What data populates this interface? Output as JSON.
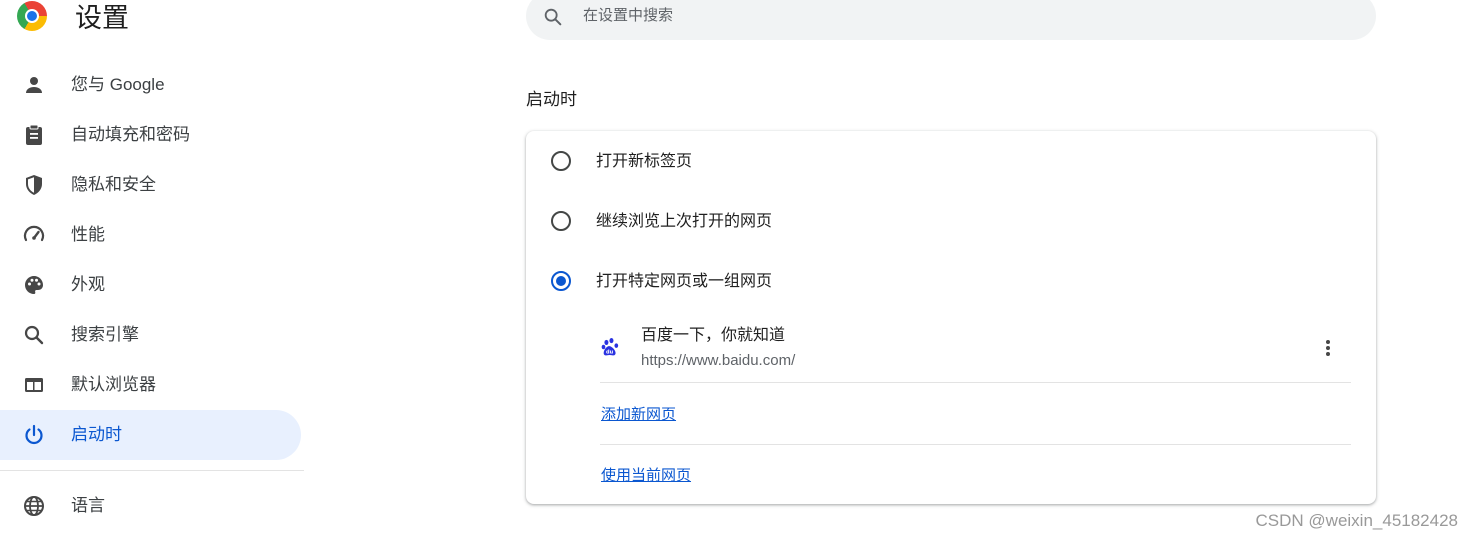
{
  "app": {
    "title": "设置",
    "logo_icon": "chrome-logo-icon"
  },
  "search": {
    "placeholder": "在设置中搜索",
    "icon": "search-icon"
  },
  "sidebar": {
    "items": [
      {
        "label": "您与 Google",
        "icon": "person-icon",
        "active": false
      },
      {
        "label": "自动填充和密码",
        "icon": "clipboard-icon",
        "active": false
      },
      {
        "label": "隐私和安全",
        "icon": "shield-icon",
        "active": false
      },
      {
        "label": "性能",
        "icon": "speedometer-icon",
        "active": false
      },
      {
        "label": "外观",
        "icon": "palette-icon",
        "active": false
      },
      {
        "label": "搜索引擎",
        "icon": "search-icon",
        "active": false
      },
      {
        "label": "默认浏览器",
        "icon": "browser-window-icon",
        "active": false
      },
      {
        "label": "启动时",
        "icon": "power-icon",
        "active": true
      },
      {
        "label": "语言",
        "icon": "globe-icon",
        "active": false
      }
    ]
  },
  "main": {
    "section_title": "启动时",
    "options": [
      {
        "label": "打开新标签页",
        "checked": false
      },
      {
        "label": "继续浏览上次打开的网页",
        "checked": false
      },
      {
        "label": "打开特定网页或一组网页",
        "checked": true
      }
    ],
    "pages": [
      {
        "title": "百度一下，你就知道",
        "url": "https://www.baidu.com/",
        "favicon": "baidu-paw-icon"
      }
    ],
    "add_page_link": "添加新网页",
    "use_current_link": "使用当前网页"
  },
  "watermark": "CSDN @weixin_45182428",
  "colors": {
    "accent": "#0b57d0",
    "active_bg": "#e8f0fe",
    "search_bg": "#f1f3f4"
  }
}
